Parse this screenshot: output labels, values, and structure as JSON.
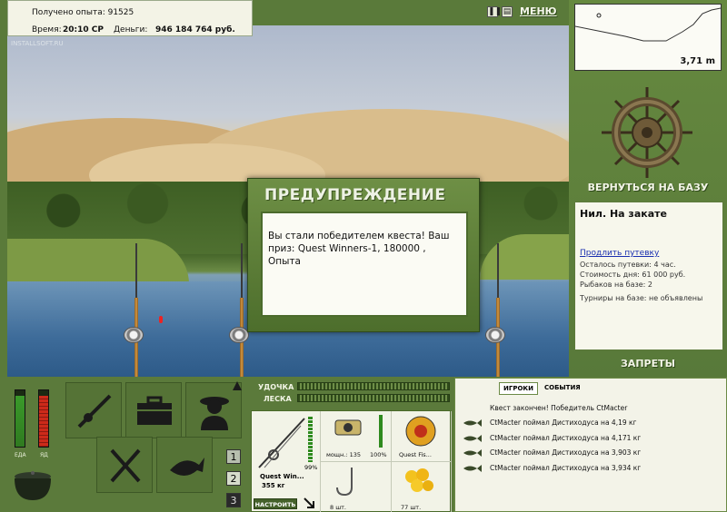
{
  "topbar": {
    "experience_label": "Получено опыта: 91525",
    "time_label": "Время:",
    "time_value": "20:10 СР",
    "money_label": "Деньги:",
    "money_value": "946 184 764 руб."
  },
  "menu": {
    "pause_icon": "pause-icon",
    "stats_icon": "chart-icon",
    "menu_label": "МЕНЮ"
  },
  "scene": {
    "watermark": "INSTALLSOFT.RU"
  },
  "dialog": {
    "title": "ПРЕДУПРЕЖДЕНИЕ",
    "message": "Вы стали победителем квеста! Ваш приз: Quest Winners-1, 180000 , Опыта"
  },
  "right_panel": {
    "depth_value": "3,71 m",
    "return_base": "ВЕРНУТЬСЯ НА БАЗУ",
    "location": "Нил. На закате",
    "extend_trip": "Продлить путевку",
    "trip_left": "Осталось путевки: 4 час.",
    "day_cost": "Стоимость дня: 61 000 руб.",
    "fishers": "Рыбаков на базе: 2",
    "tournaments": "Турниры на базе: не объявлены",
    "bans": "ЗАПРЕТЫ"
  },
  "meters": {
    "food_label": "ЕДА",
    "poison_label": "ЯД",
    "food_level": 0.9,
    "poison_level": 0.9
  },
  "tools": {
    "rods_icon": "fishing-rod-icon",
    "box_icon": "tackle-box-icon",
    "fisher_icon": "fisherman-icon",
    "food_icon": "fork-knife-icon",
    "fish_icon": "fish-icon",
    "pot_icon": "pot-icon",
    "slot_numbers": [
      "1",
      "2",
      "3"
    ]
  },
  "bars": {
    "rod_label": "УДОЧКА",
    "line_label": "ЛЕСКА"
  },
  "tackle": {
    "rod_name": "Quest Win...",
    "rod_weight": "355 кг",
    "rod_percent": "99%",
    "reel_power": "мощн.: 135",
    "reel_percent": "100%",
    "line_name": "Quest Fis...",
    "hook_count": "8 шт.",
    "bait_count": "77 шт.",
    "setup_button": "НАСТРОИТЬ"
  },
  "chat": {
    "tab_players": "ИГРОКИ",
    "tab_events": "СОБЫТИЯ",
    "quest_msg": "Квест закончен! Победитель CtMacter",
    "messages": [
      "CtMacter поймал Дистиходуса на 4,19 кг",
      "CtMacter поймал Дистиходуса на 4,171 кг",
      "CtMacter поймал Дистиходуса на 3,903 кг",
      "CtMacter поймал Дистиходуса на 3,934 кг"
    ]
  },
  "colors": {
    "panel_green": "#5b7a3b",
    "accent_text": "#f2f4e6",
    "link_blue": "#1a2fb0"
  }
}
